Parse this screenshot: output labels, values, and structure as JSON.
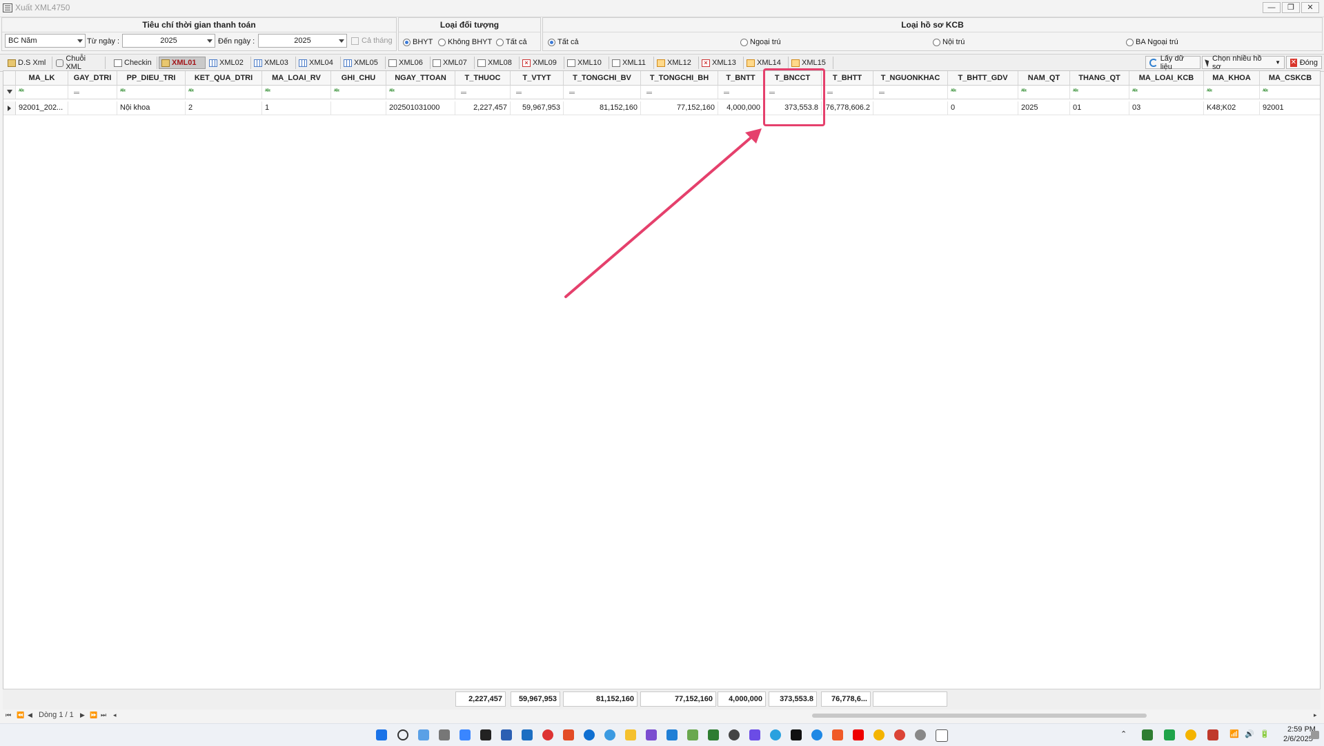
{
  "window": {
    "title": "Xuất XML4750",
    "minimize": "—",
    "restore": "❐",
    "close": "✕"
  },
  "criteria": {
    "time_title": "Tiêu chí thời gian thanh toán",
    "period_value": "BC Năm",
    "from_label": "Từ ngày :",
    "from_value": "2025",
    "to_label": "Đến ngày :",
    "to_value": "2025",
    "whole_month_label": "Cả tháng",
    "object_title": "Loại đối tượng",
    "object_options": [
      "BHYT",
      "Không BHYT",
      "Tất cả"
    ],
    "object_selected": "BHYT",
    "record_title": "Loại hồ sơ KCB",
    "record_options": [
      "Tất cả",
      "Ngoại trú",
      "Nội trú",
      "BA Ngoại trú"
    ],
    "record_selected": "Tất cả"
  },
  "tabs": [
    {
      "label": "D.S Xml",
      "icon": "clipboard-icon"
    },
    {
      "label": "Chuỗi XML",
      "icon": "chain-icon"
    },
    {
      "label": "Checkin",
      "icon": "document-icon"
    },
    {
      "label": "XML01",
      "icon": "lock-icon",
      "active": true
    },
    {
      "label": "XML02",
      "icon": "grid-icon"
    },
    {
      "label": "XML03",
      "icon": "grid-icon"
    },
    {
      "label": "XML04",
      "icon": "grid-icon"
    },
    {
      "label": "XML05",
      "icon": "grid-icon"
    },
    {
      "label": "XML06",
      "icon": "document-icon"
    },
    {
      "label": "XML07",
      "icon": "document-icon"
    },
    {
      "label": "XML08",
      "icon": "document-icon"
    },
    {
      "label": "XML09",
      "icon": "x-icon"
    },
    {
      "label": "XML10",
      "icon": "document-icon"
    },
    {
      "label": "XML11",
      "icon": "document-icon"
    },
    {
      "label": "XML12",
      "icon": "image-icon"
    },
    {
      "label": "XML13",
      "icon": "x-icon"
    },
    {
      "label": "XML14",
      "icon": "image-icon"
    },
    {
      "label": "XML15",
      "icon": "image-icon"
    }
  ],
  "toolbar": {
    "fetch_label": "Lấy dữ liệu",
    "select_label": "Chọn nhiều hồ sơ",
    "close_label": "Đóng"
  },
  "grid": {
    "columns": [
      "MA_LK",
      "GAY_DTRI",
      "PP_DIEU_TRI",
      "KET_QUA_DTRI",
      "MA_LOAI_RV",
      "GHI_CHU",
      "NGAY_TTOAN",
      "T_THUOC",
      "T_VTYT",
      "T_TONGCHI_BV",
      "T_TONGCHI_BH",
      "T_BNTT",
      "T_BNCCT",
      "T_BHTT",
      "T_NGUONKHAC",
      "T_BHTT_GDV",
      "NAM_QT",
      "THANG_QT",
      "MA_LOAI_KCB",
      "MA_KHOA",
      "MA_CSKCB"
    ],
    "row": [
      "92001_202...",
      "",
      "Nội khoa",
      "2",
      "1",
      "",
      "202501031000",
      "2,227,457",
      "59,967,953",
      "81,152,160",
      "77,152,160",
      "4,000,000",
      "373,553.8",
      "76,778,606.2",
      "",
      "0",
      "2025",
      "01",
      "03",
      "K48;K02",
      "92001"
    ],
    "sums": [
      "2,227,457",
      "59,967,953",
      "81,152,160",
      "77,152,160",
      "4,000,000",
      "373,553.8",
      "76,778,6...",
      ""
    ]
  },
  "navigator": {
    "record_text": "Dòng 1 / 1"
  },
  "taskbar": {
    "time": "2:59 PM",
    "date": "2/6/2025"
  },
  "colors": {
    "highlight": "#e5406c",
    "accent": "#3d7bd6",
    "active_tab_text": "#a3161a"
  }
}
